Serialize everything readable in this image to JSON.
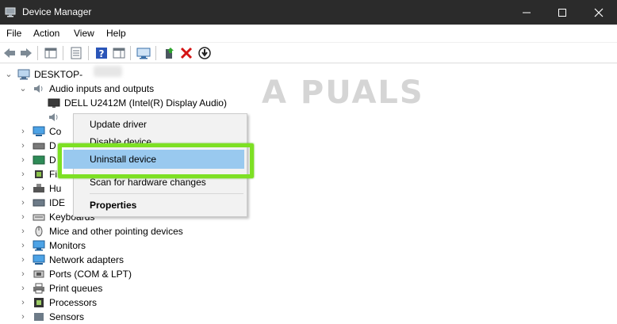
{
  "window": {
    "title": "Device Manager"
  },
  "menu": {
    "file": "File",
    "action": "Action",
    "view": "View",
    "help": "Help"
  },
  "toolbar_icons": [
    "back-arrow-icon",
    "forward-arrow-icon",
    "show-hide-tree-icon",
    "properties-icon",
    "help-icon",
    "action-pane-icon",
    "scan-hardware-icon",
    "update-driver-icon",
    "uninstall-x-icon",
    "download-driver-icon"
  ],
  "tree": {
    "root": "DESKTOP-",
    "audio": {
      "label": "Audio inputs and outputs",
      "children": [
        "DELL U2412M (Intel(R) Display Audio)"
      ]
    },
    "partial": [
      "Co",
      "D",
      "D",
      "Fi",
      "Hu",
      "IDE"
    ],
    "categories": [
      "Keyboards",
      "Mice and other pointing devices",
      "Monitors",
      "Network adapters",
      "Ports (COM & LPT)",
      "Print queues",
      "Processors",
      "Sensors"
    ]
  },
  "context_menu": {
    "update": "Update driver",
    "disable": "Disable device",
    "uninstall": "Uninstall device",
    "scan": "Scan for hardware changes",
    "properties": "Properties"
  },
  "watermark": "A  PUALS",
  "colors": {
    "titlebar": "#2b2b2b",
    "selection": "#99c9ef",
    "highlight_frame": "#7de023"
  }
}
